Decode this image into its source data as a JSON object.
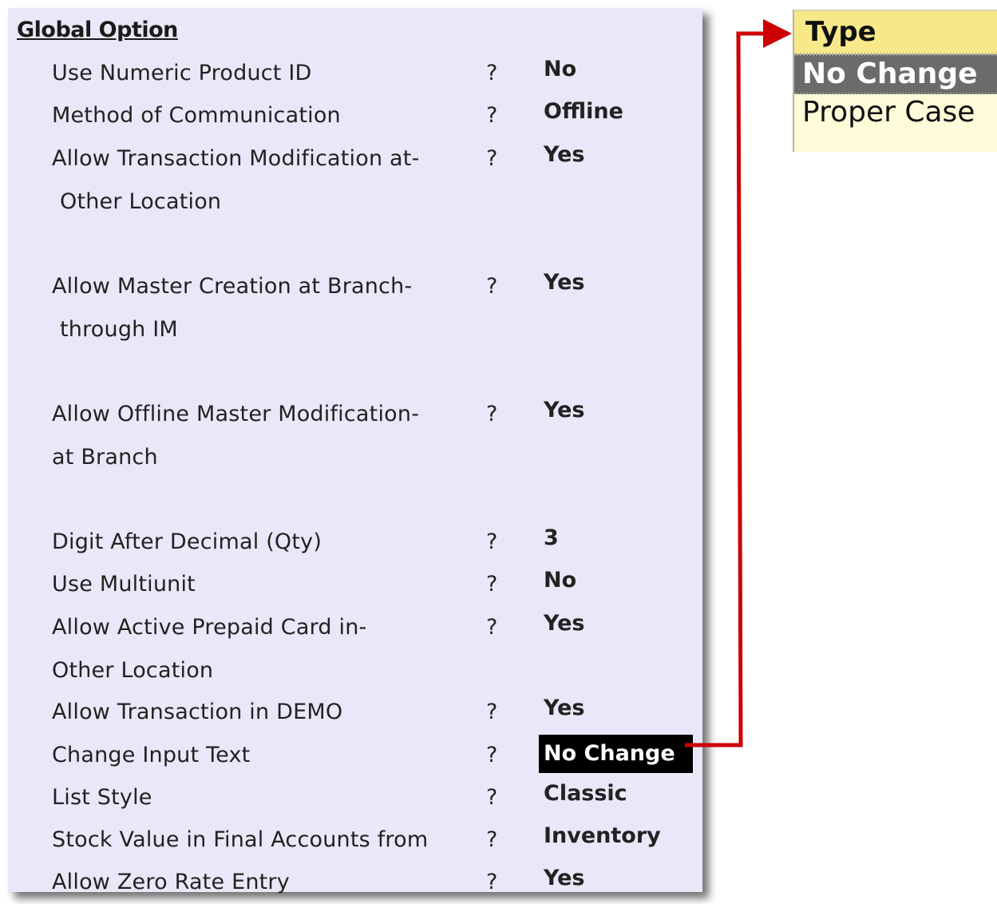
{
  "panel": {
    "title": "Global Option"
  },
  "options": [
    {
      "label": "Use Numeric Product ID",
      "label2": "",
      "q": "?",
      "value": "No"
    },
    {
      "label": "Method of Communication",
      "label2": "",
      "q": "?",
      "value": "Offline"
    },
    {
      "label": "Allow Transaction Modification at-",
      "label2": " Other Location",
      "q": "?",
      "value": "Yes"
    },
    {
      "label": "Allow Master Creation at Branch-",
      "label2": " through IM",
      "q": "?",
      "value": "Yes"
    },
    {
      "label": "Allow Offline Master Modification-",
      "label2": "at Branch",
      "q": "?",
      "value": "Yes"
    },
    {
      "label": "Digit After Decimal (Qty)",
      "label2": "",
      "q": "?",
      "value": "3"
    },
    {
      "label": "Use Multiunit",
      "label2": "",
      "q": "?",
      "value": "No"
    },
    {
      "label": "Allow Active Prepaid Card in-",
      "label2": "Other Location",
      "q": "?",
      "value": "Yes"
    },
    {
      "label": "Allow Transaction in DEMO",
      "label2": "",
      "q": "?",
      "value": "Yes"
    },
    {
      "label": "Change Input Text",
      "label2": "",
      "q": "?",
      "value": "No Change"
    },
    {
      "label": "List Style",
      "label2": "",
      "q": "?",
      "value": "Classic"
    },
    {
      "label": "Stock Value in Final Accounts from",
      "label2": "",
      "q": "?",
      "value": "Inventory"
    },
    {
      "label": "Allow Zero Rate Entry",
      "label2": "",
      "q": "?",
      "value": "Yes"
    }
  ],
  "type_popup": {
    "title": "Type",
    "items": [
      "No Change",
      "Proper Case"
    ],
    "selected": "No Change"
  },
  "colors": {
    "panel_bg": "#e8e8f8",
    "connector": "#cc0000",
    "popup_header": "#f7e88a",
    "popup_bg": "#fefcd8",
    "popup_selected": "#6b6b6b"
  }
}
